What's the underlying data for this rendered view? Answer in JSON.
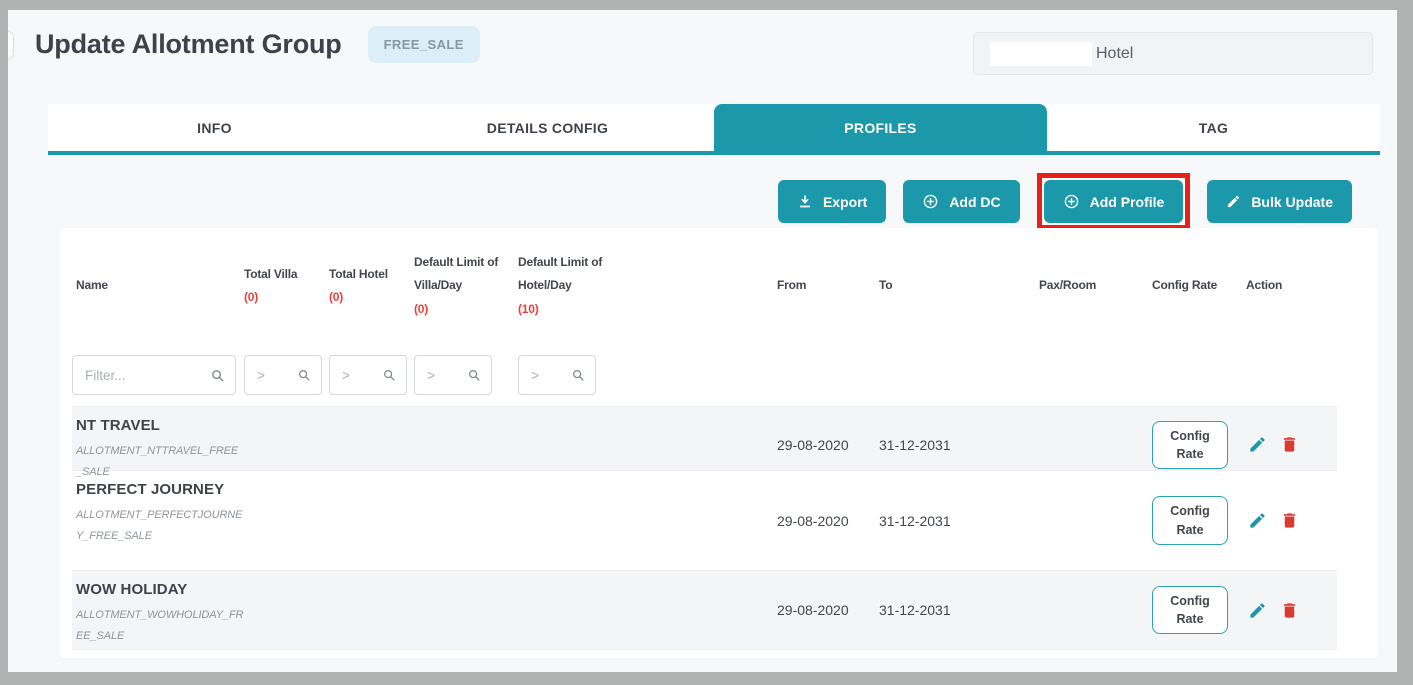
{
  "page": {
    "title": "Update Allotment Group",
    "badge": "FREE_SALE"
  },
  "hotel_field": {
    "label": "Hotel",
    "redacted": true
  },
  "tabs": [
    {
      "label": "INFO",
      "active": false
    },
    {
      "label": "DETAILS CONFIG",
      "active": false
    },
    {
      "label": "PROFILES",
      "active": true
    },
    {
      "label": "TAG",
      "active": false
    }
  ],
  "toolbar": {
    "export_label": "Export",
    "add_dc_label": "Add DC",
    "add_profile_label": "Add Profile",
    "bulk_update_label": "Bulk Update",
    "highlighted_button": "Add Profile"
  },
  "icons": {
    "export": "download-icon",
    "add_dc": "circle-plus-icon",
    "add_profile": "circle-plus-icon",
    "bulk_update": "pencil-icon",
    "filter": "search-icon",
    "edit_row": "pencil-icon",
    "delete_row": "trash-icon"
  },
  "colors": {
    "accent_teal": "#1b98a9",
    "count_red": "#e8413c",
    "danger_red": "#d93a31",
    "highlight_annotation_red": "#e8201c",
    "badge_bg": "#dceef7"
  },
  "table": {
    "columns": [
      {
        "label": "Name",
        "count": ""
      },
      {
        "label": "Total Villa",
        "count": "(0)"
      },
      {
        "label": "Total Hotel",
        "count": "(0)"
      },
      {
        "label": "Default Limit of Villa/Day",
        "count": "(0)"
      },
      {
        "label": "Default Limit of Hotel/Day",
        "count": "(10)"
      },
      {
        "label": "From",
        "count": ""
      },
      {
        "label": "To",
        "count": ""
      },
      {
        "label": "Pax/Room",
        "count": ""
      },
      {
        "label": "Config Rate",
        "count": ""
      },
      {
        "label": "Action",
        "count": ""
      }
    ],
    "filters": [
      {
        "placeholder": "Filter..."
      },
      {
        "placeholder": ">"
      },
      {
        "placeholder": ">"
      },
      {
        "placeholder": ">"
      },
      {
        "placeholder": ">"
      }
    ],
    "config_rate_button": "Config Rate",
    "rows": [
      {
        "name": "NT TRAVEL",
        "code": "ALLOTMENT_NTTRAVEL_FREE_SALE",
        "from": "29-08-2020",
        "to": "31-12-2031",
        "pax_room": ""
      },
      {
        "name": "PERFECT JOURNEY",
        "code": "ALLOTMENT_PERFECTJOURNEY_FREE_SALE",
        "from": "29-08-2020",
        "to": "31-12-2031",
        "pax_room": ""
      },
      {
        "name": "WOW HOLIDAY",
        "code": "ALLOTMENT_WOWHOLIDAY_FREE_SALE",
        "from": "29-08-2020",
        "to": "31-12-2031",
        "pax_room": ""
      }
    ]
  }
}
